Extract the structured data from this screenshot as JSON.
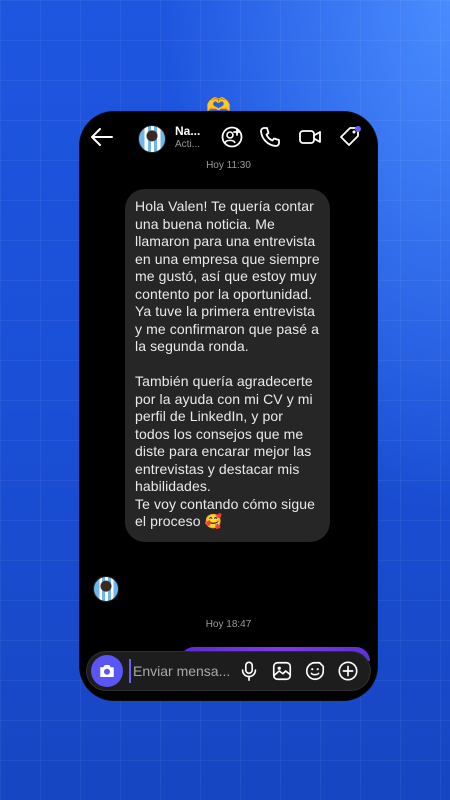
{
  "decoration": {
    "heart_emoji": "🫶"
  },
  "header": {
    "contact_name": "Na...",
    "contact_status": "Acti..."
  },
  "chat": {
    "timestamp_top": "Hoy 11:30",
    "message_text": "Hola Valen! Te quería contar una buena noticia. Me llamaron para una entrevista en una empresa que siempre me gustó, así que estoy muy contento por la oportunidad.\nYa tuve la primera entrevista y me confirmaron que pasé a la segunda ronda.\n\nTambién quería agradecerte por la ayuda con mi CV y mi perfil de LinkedIn, y por todos los consejos que me diste para encarar mejor las entrevistas y destacar mis habilidades.\nTe voy contando cómo sigue el proceso 🥰",
    "timestamp_bottom": "Hoy 18:47"
  },
  "composer": {
    "placeholder": "Enviar mensa..."
  },
  "colors": {
    "background": "#1f56e0",
    "accent_camera": "#5a56f5",
    "bubble": "#262626",
    "sent_bubble": "#7b3be8"
  },
  "icons": [
    "back-arrow-icon",
    "add-person-icon",
    "phone-icon",
    "video-call-icon",
    "tag-icon",
    "camera-icon",
    "microphone-icon",
    "gallery-icon",
    "sticker-icon",
    "plus-icon"
  ]
}
